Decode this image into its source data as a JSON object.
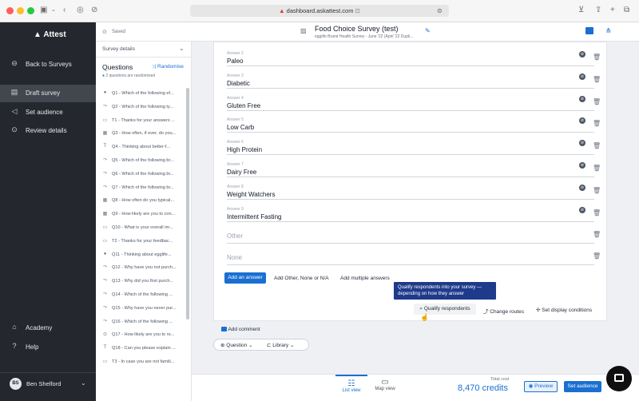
{
  "browser": {
    "url": "dashboard.askattest.com"
  },
  "sidebar": {
    "logo": "Attest",
    "items": [
      {
        "label": "Back to Surveys",
        "icon": "arrow-left-icon"
      },
      {
        "label": "Draft survey",
        "icon": "document-icon"
      },
      {
        "label": "Set audience",
        "icon": "megaphone-icon"
      },
      {
        "label": "Review details",
        "icon": "check-circle-icon"
      },
      {
        "label": "Academy",
        "icon": "academy-icon"
      },
      {
        "label": "Help",
        "icon": "help-icon"
      }
    ],
    "user": {
      "initials": "BS",
      "name": "Ben Shelford"
    }
  },
  "header": {
    "saved": "Saved",
    "title": "Food Choice Survey (test)",
    "subtitle": "egglife Brand Health Survey - June '22 (April '22 Dupli..."
  },
  "panel": {
    "section": "Survey details",
    "title": "Questions",
    "randomise": "Randomise",
    "note": "2 questions are randomised",
    "questions": [
      {
        "icon": "●",
        "label": "Q1 - Which of the following ef..."
      },
      {
        "icon": "⤳",
        "label": "Q2 - Which of the following ty..."
      },
      {
        "icon": "▭",
        "label": "T1 - Thanks for your answers ..."
      },
      {
        "icon": "▦",
        "label": "Q3 - How often, if ever, do you..."
      },
      {
        "icon": "T",
        "label": "Q4 - Thinking about better-f..."
      },
      {
        "icon": "⤳",
        "label": "Q5 - Which of the following br..."
      },
      {
        "icon": "⤳",
        "label": "Q6 - Which of the following br..."
      },
      {
        "icon": "⤳",
        "label": "Q7 - Which of the following br..."
      },
      {
        "icon": "▦",
        "label": "Q8 - How often do you typical..."
      },
      {
        "icon": "▦",
        "label": "Q9 - How likely are you to con..."
      },
      {
        "icon": "▭",
        "label": "Q10 - What is your overall im..."
      },
      {
        "icon": "▭",
        "label": "T2 - Thanks for your feedbac..."
      },
      {
        "icon": "●",
        "label": "Q11 - Thinking about egglife..."
      },
      {
        "icon": "⤳",
        "label": "Q12 - Why have you not purch..."
      },
      {
        "icon": "⤳",
        "label": "Q13 - Why did you first purch..."
      },
      {
        "icon": "⤳",
        "label": "Q14 - Which of the following ..."
      },
      {
        "icon": "⤳",
        "label": "Q15 - Why have you never pur..."
      },
      {
        "icon": "⤳",
        "label": "Q16 - Which of the following ..."
      },
      {
        "icon": "⊙",
        "label": "Q17 - How likely are you to re..."
      },
      {
        "icon": "T",
        "label": "Q18 - Can you please explain ..."
      },
      {
        "icon": "▭",
        "label": "T3 - In case you are not famili..."
      }
    ]
  },
  "answers": [
    {
      "label": "Answer 2",
      "value": "Paleo"
    },
    {
      "label": "Answer 3",
      "value": "Diabetic"
    },
    {
      "label": "Answer 4",
      "value": "Gluten Free"
    },
    {
      "label": "Answer 5",
      "value": "Low Carb"
    },
    {
      "label": "Answer 6",
      "value": "High Protein"
    },
    {
      "label": "Answer 7",
      "value": "Dairy Free"
    },
    {
      "label": "Answer 8",
      "value": "Weight Watchers"
    },
    {
      "label": "Answer 9",
      "value": "Intermittent Fasting"
    }
  ],
  "extra_answers": [
    "Other",
    "None"
  ],
  "actions": {
    "add_answer": "Add an answer",
    "add_other": "Add Other, None or N/A",
    "add_multiple": "Add multiple answers",
    "tooltip": "Qualify respondents into your survey — depending on how they answer",
    "qualify": "Qualify respondents",
    "change_routes": "Change routes",
    "display_conditions": "Set display conditions",
    "add_comment": "Add comment",
    "question": "Question",
    "library": "Library"
  },
  "footer": {
    "list_view": "List view",
    "map_view": "Map view",
    "total_cost_label": "Total cost",
    "credits": "8,470 credits",
    "preview": "Preview",
    "set_audience": "Set audience"
  },
  "colors": {
    "accent": "#1a6fd1",
    "sidebar": "#24272d",
    "tooltip": "#1e3a8a"
  }
}
